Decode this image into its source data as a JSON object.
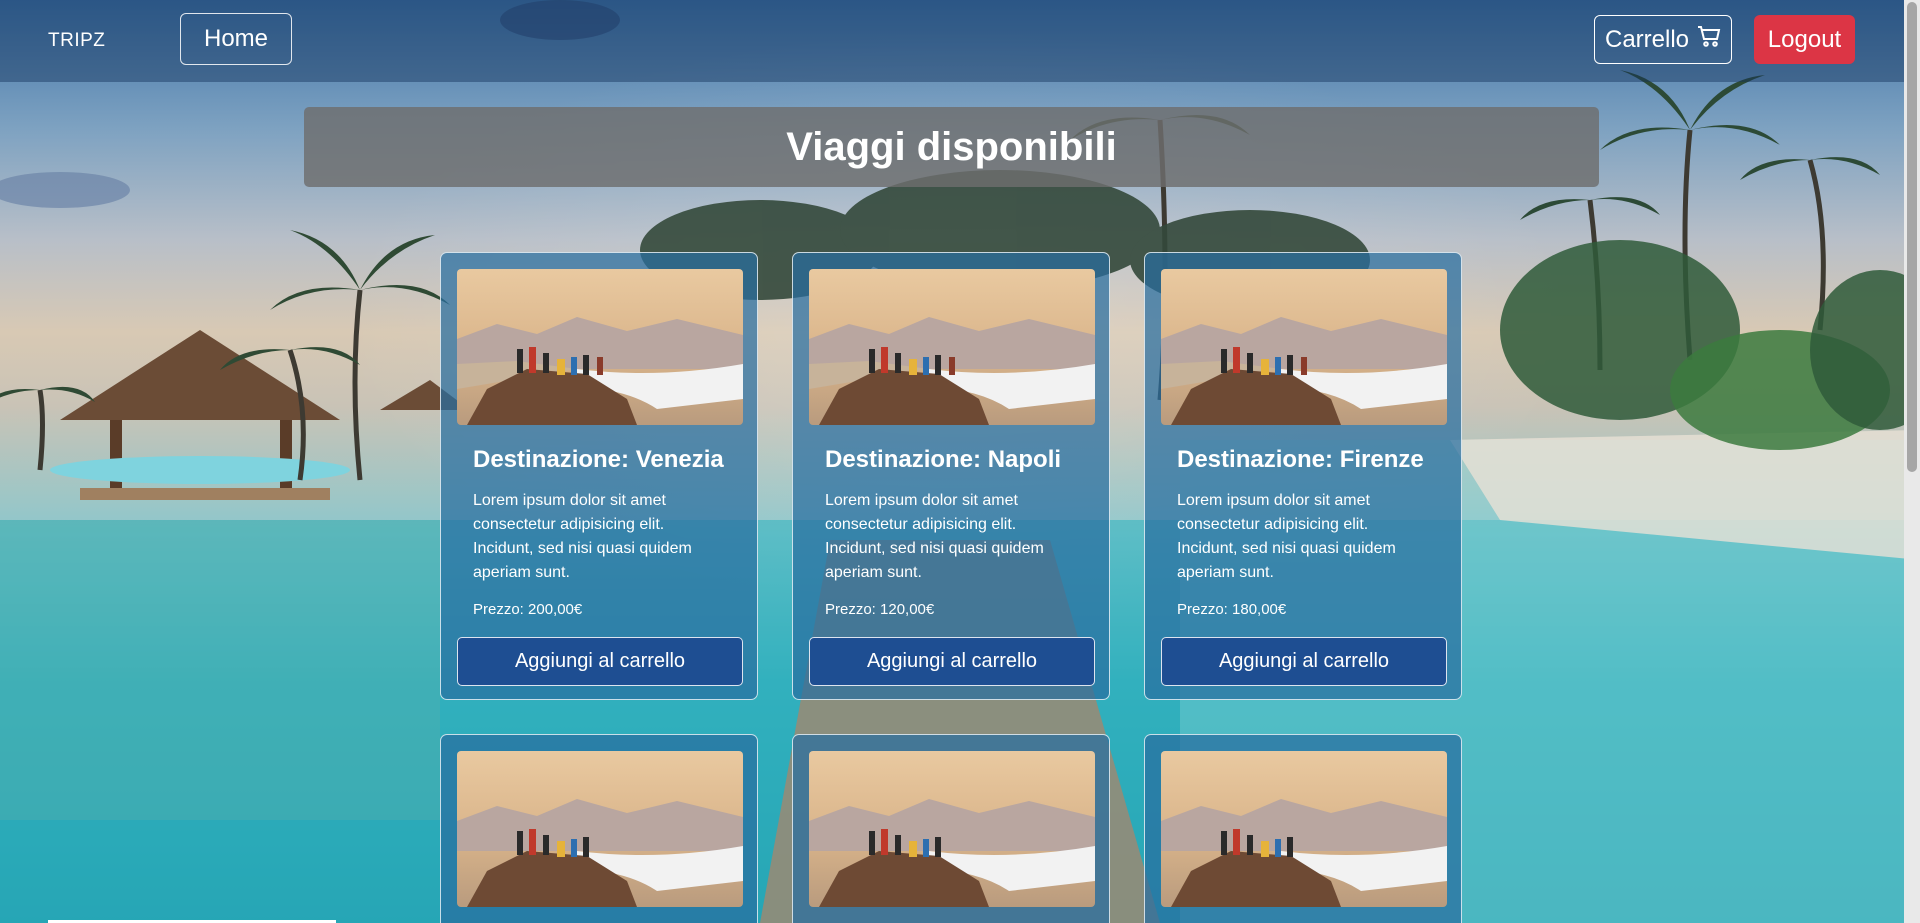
{
  "navbar": {
    "brand": "TRIPZ",
    "home_label": "Home",
    "cart_label": "Carrello",
    "cart_icon": "cart-icon",
    "logout_label": "Logout"
  },
  "page_title": "Viaggi disponibili",
  "cards": [
    {
      "title": "Destinazione: Venezia",
      "text": "Lorem ipsum dolor sit amet consectetur adipisicing elit. Incidunt, sed nisi quasi quidem aperiam sunt.",
      "price": "Prezzo: 200,00€",
      "button": "Aggiungi al carrello"
    },
    {
      "title": "Destinazione: Napoli",
      "text": "Lorem ipsum dolor sit amet consectetur adipisicing elit. Incidunt, sed nisi quasi quidem aperiam sunt.",
      "price": "Prezzo: 120,00€",
      "button": "Aggiungi al carrello"
    },
    {
      "title": "Destinazione: Firenze",
      "text": "Lorem ipsum dolor sit amet consectetur adipisicing elit. Incidunt, sed nisi quasi quidem aperiam sunt.",
      "price": "Prezzo: 180,00€",
      "button": "Aggiungi al carrello"
    }
  ],
  "colors": {
    "logout": "#dc3545",
    "card_button": "#1e4e92",
    "card_bg": "#286ea0"
  }
}
